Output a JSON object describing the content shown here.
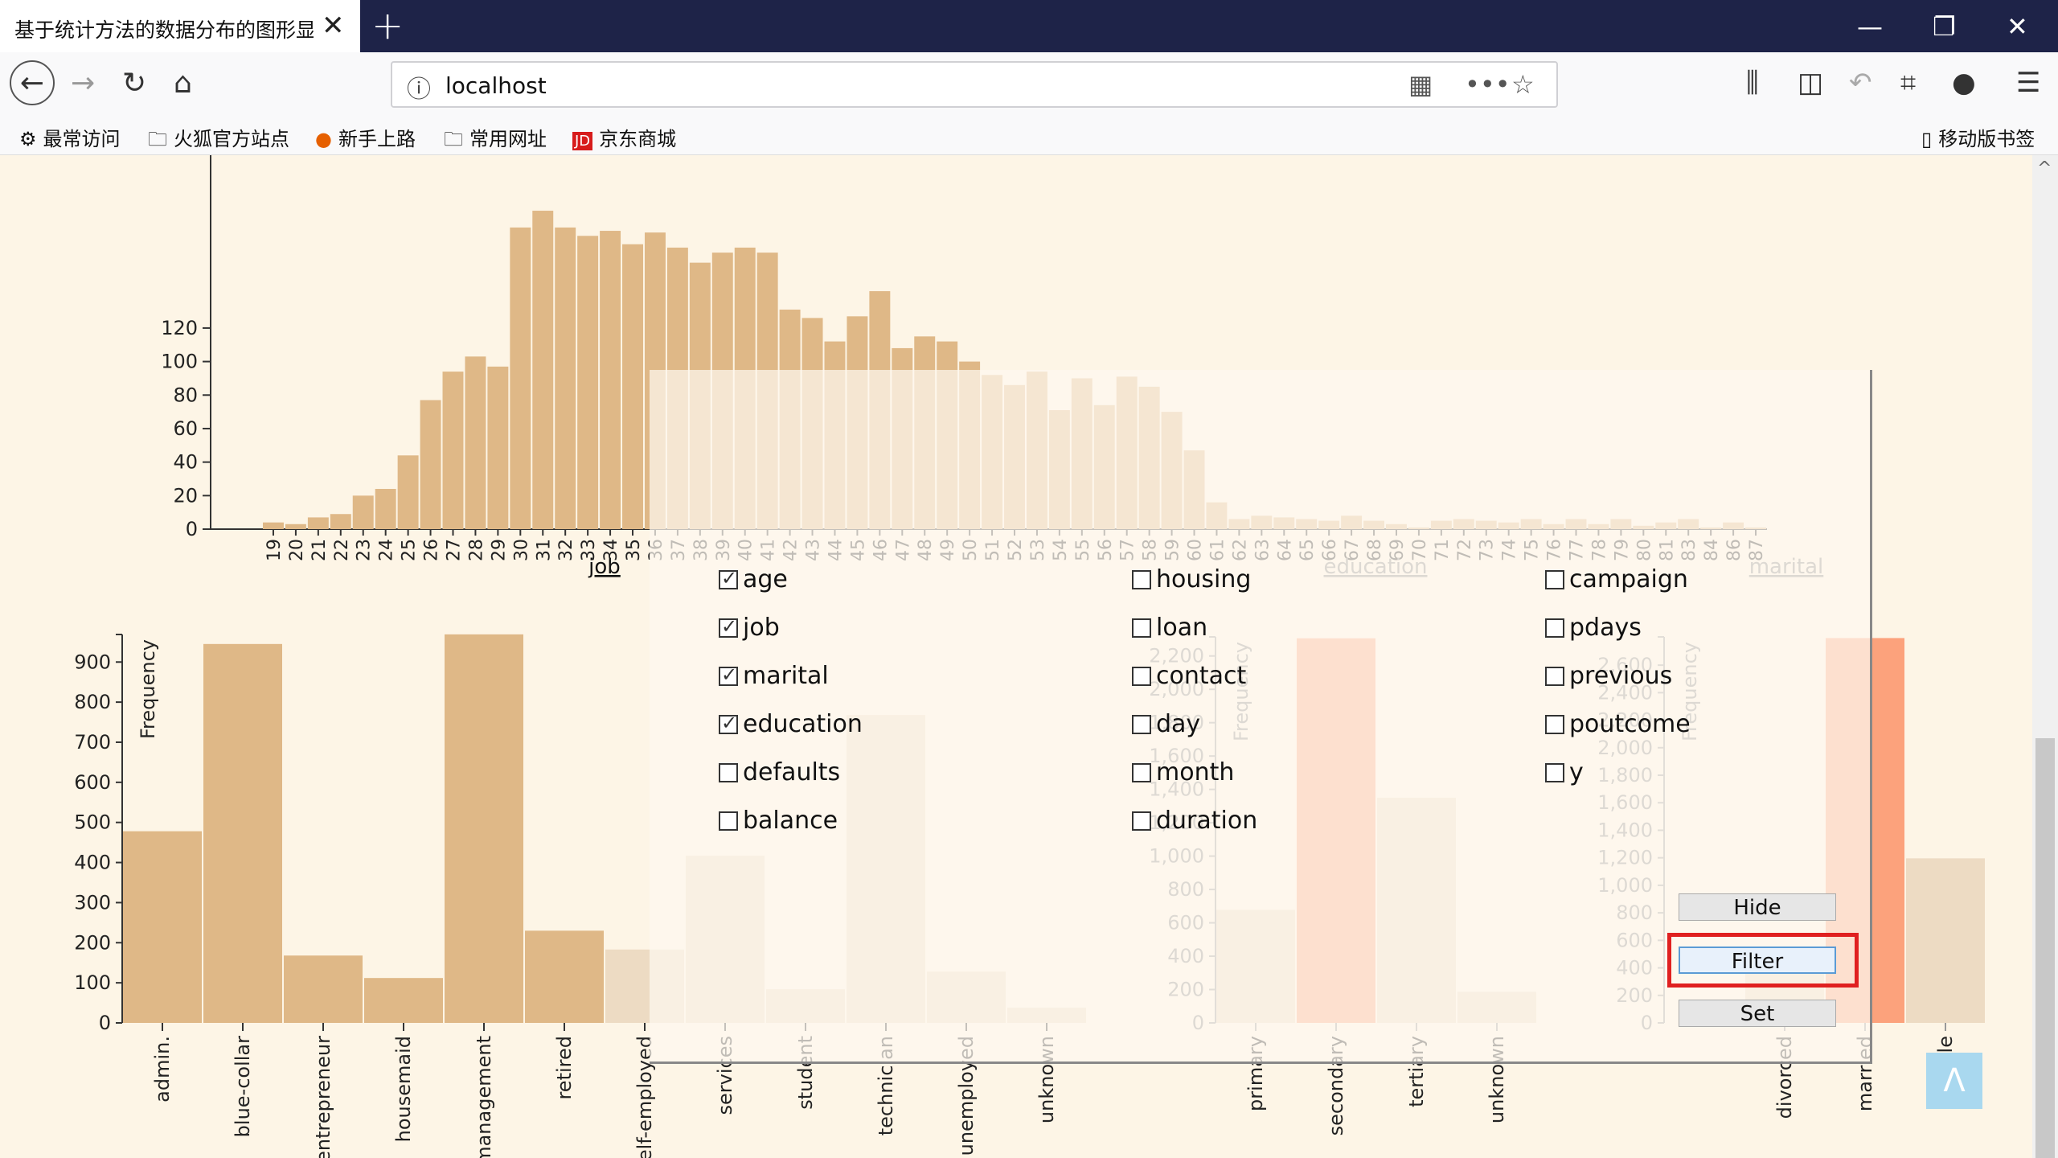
{
  "browser": {
    "tab_title": "基于统计方法的数据分布的图形显示",
    "new_tab": "+",
    "url": "localhost",
    "bookmarks": [
      "最常访问",
      "火狐官方站点",
      "新手上路",
      "常用网址",
      "京东商城"
    ],
    "mobile_bookmarks": "移动版书签"
  },
  "colors": {
    "bar": "#dfb887",
    "bar_light": "#eddbc3",
    "highlight": "#fca27c"
  },
  "age_histogram": {
    "categories": [
      "19",
      "20",
      "21",
      "22",
      "23",
      "24",
      "25",
      "26",
      "27",
      "28",
      "29",
      "30",
      "31",
      "32",
      "33",
      "34",
      "35",
      "36",
      "37",
      "38",
      "39",
      "40",
      "41",
      "42",
      "43",
      "44",
      "45",
      "46",
      "47",
      "48",
      "49",
      "50",
      "51",
      "52",
      "53",
      "54",
      "55",
      "56",
      "57",
      "58",
      "59",
      "60",
      "61",
      "62",
      "63",
      "64",
      "65",
      "66",
      "67",
      "68",
      "69",
      "70",
      "71",
      "72",
      "73",
      "74",
      "75",
      "76",
      "77",
      "78",
      "79",
      "80",
      "81",
      "83",
      "84",
      "86",
      "87"
    ],
    "values": [
      4,
      3,
      7,
      9,
      20,
      24,
      44,
      77,
      94,
      103,
      97,
      180,
      190,
      180,
      175,
      178,
      170,
      177,
      168,
      159,
      165,
      168,
      165,
      131,
      126,
      112,
      127,
      142,
      108,
      115,
      112,
      100,
      92,
      86,
      94,
      71,
      90,
      74,
      91,
      85,
      70,
      47,
      16,
      6,
      8,
      7,
      6,
      5,
      8,
      5,
      3,
      1,
      5,
      6,
      5,
      4,
      6,
      3,
      6,
      3,
      6,
      2,
      4,
      6,
      1,
      4,
      1
    ],
    "ylim": [
      0,
      130
    ],
    "yticks": [
      "0",
      "20",
      "40",
      "60",
      "80",
      "100",
      "120"
    ]
  },
  "chart_data": [
    {
      "type": "bar",
      "title": "job",
      "ylabel": "Frequency",
      "categories": [
        "admin.",
        "blue-collar",
        "entrepreneur",
        "housemaid",
        "management",
        "retired",
        "self-employed",
        "services",
        "student",
        "technician",
        "unemployed",
        "unknown"
      ],
      "values": [
        478,
        945,
        168,
        112,
        969,
        230,
        183,
        417,
        84,
        768,
        128,
        38
      ],
      "ylim": [
        0,
        1000
      ],
      "yticks": [
        "0",
        "100",
        "200",
        "300",
        "400",
        "500",
        "600",
        "700",
        "800",
        "900"
      ]
    },
    {
      "type": "bar",
      "title": "education",
      "ylabel": "Frequency",
      "categories": [
        "primary",
        "secondary",
        "tertiary",
        "unknown"
      ],
      "values": [
        678,
        2306,
        1350,
        187
      ],
      "highlight": "secondary",
      "ylim": [
        0,
        2300
      ],
      "yticks": [
        "0",
        "200",
        "400",
        "600",
        "800",
        "1,000",
        "1,200",
        "1,400",
        "1,600",
        "1,800",
        "2,000",
        "2,200"
      ]
    },
    {
      "type": "bar",
      "title": "marital",
      "ylabel": "Frequency",
      "categories": [
        "divorced",
        "married",
        "single"
      ],
      "values": [
        528,
        2797,
        1196
      ],
      "highlight": "married",
      "ylim": [
        0,
        2800
      ],
      "yticks": [
        "0",
        "200",
        "400",
        "600",
        "800",
        "1,000",
        "1,200",
        "1,400",
        "1,600",
        "1,800",
        "2,000",
        "2,200",
        "2,400",
        "2,600"
      ]
    }
  ],
  "panel": {
    "checkboxes": [
      {
        "label": "age",
        "checked": true
      },
      {
        "label": "job",
        "checked": true
      },
      {
        "label": "marital",
        "checked": true
      },
      {
        "label": "education",
        "checked": true
      },
      {
        "label": "defaults",
        "checked": false
      },
      {
        "label": "balance",
        "checked": false
      },
      {
        "label": "housing",
        "checked": false
      },
      {
        "label": "loan",
        "checked": false
      },
      {
        "label": "contact",
        "checked": false
      },
      {
        "label": "day",
        "checked": false
      },
      {
        "label": "month",
        "checked": false
      },
      {
        "label": "duration",
        "checked": false
      },
      {
        "label": "campaign",
        "checked": false
      },
      {
        "label": "pdays",
        "checked": false
      },
      {
        "label": "previous",
        "checked": false
      },
      {
        "label": "poutcome",
        "checked": false
      },
      {
        "label": "y",
        "checked": false
      }
    ],
    "hide_label": "Hide",
    "filter_label": "Filter",
    "set_label": "Set"
  },
  "back_to_top": "Λ"
}
